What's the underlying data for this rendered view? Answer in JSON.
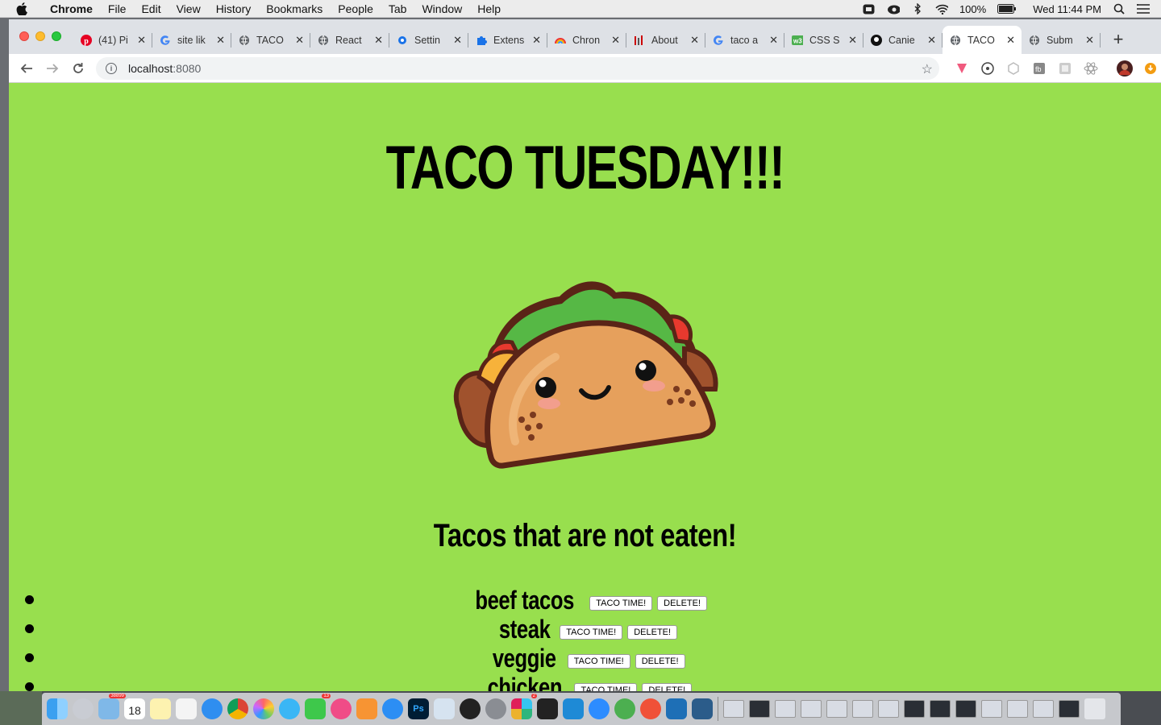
{
  "menubar": {
    "app_name": "Chrome",
    "items": [
      "File",
      "Edit",
      "View",
      "History",
      "Bookmarks",
      "People",
      "Tab",
      "Window",
      "Help"
    ],
    "battery": "100%",
    "datetime": "Wed 11:44 PM"
  },
  "browser": {
    "tabs": [
      {
        "label": "(41) Pi",
        "icon": "pinterest-icon",
        "color": "#e60023"
      },
      {
        "label": "site lik",
        "icon": "google-icon",
        "color": "#4285f4"
      },
      {
        "label": "TACO",
        "icon": "globe-icon",
        "color": "#5f6368"
      },
      {
        "label": "React",
        "icon": "globe-icon",
        "color": "#5f6368"
      },
      {
        "label": "Settin",
        "icon": "gear-icon",
        "color": "#1a73e8"
      },
      {
        "label": "Extens",
        "icon": "puzzle-icon",
        "color": "#1a73e8"
      },
      {
        "label": "Chron",
        "icon": "rainbow-icon",
        "color": "#f4b400"
      },
      {
        "label": "About",
        "icon": "bars-icon",
        "color": "#c00"
      },
      {
        "label": "taco a",
        "icon": "google-icon",
        "color": "#4285f4"
      },
      {
        "label": "CSS S",
        "icon": "w3-icon",
        "color": "#4caf50"
      },
      {
        "label": "Caniе",
        "icon": "github-icon",
        "color": "#111"
      },
      {
        "label": "TACO",
        "icon": "globe-icon",
        "color": "#5f6368",
        "active": true
      },
      {
        "label": "Subm",
        "icon": "globe-icon",
        "color": "#5f6368"
      }
    ],
    "url_host": "localhost",
    "url_port": ":8080"
  },
  "page": {
    "title": "TACO TUESDAY!!!",
    "subtitle": "Tacos that are not eaten!",
    "tacos": [
      {
        "name": "beef tacos",
        "eat_label": "TACO TIME!",
        "delete_label": "DELETE!"
      },
      {
        "name": "steak",
        "eat_label": "TACO TIME!",
        "delete_label": "DELETE!"
      },
      {
        "name": "veggie",
        "eat_label": "TACO TIME!",
        "delete_label": "DELETE!"
      },
      {
        "name": "chicken",
        "eat_label": "TACO TIME!",
        "delete_label": "DELETE!"
      }
    ],
    "background_color": "#98df4e"
  },
  "dock": {
    "badges": [
      "38899",
      "13",
      "2"
    ],
    "calendar_day": "18"
  }
}
